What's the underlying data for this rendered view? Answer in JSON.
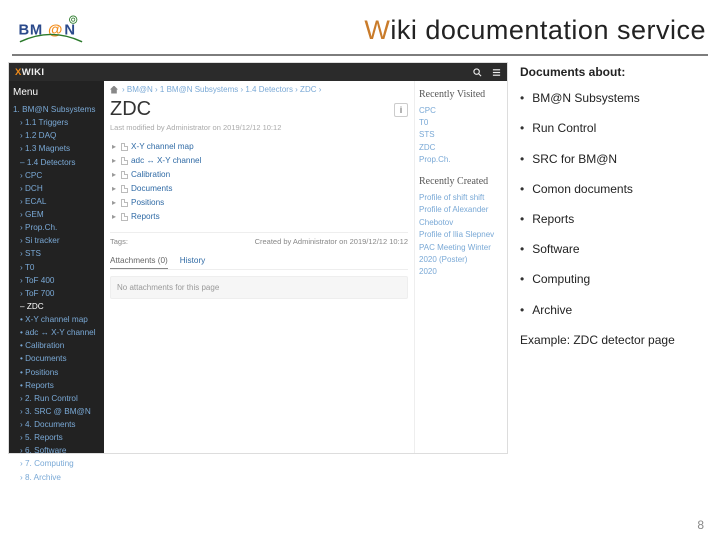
{
  "slide": {
    "title_pre": "W",
    "title_rest": "iki documentation service",
    "page_number": "8"
  },
  "logo": {
    "text": "BM@N"
  },
  "wiki": {
    "brand_x": "X",
    "brand_rest": "WIKI",
    "menu_heading": "Menu",
    "sidebar_items": [
      "1. BM@N Subsystems",
      "› 1.1 Triggers",
      "› 1.2 DAQ",
      "› 1.3 Magnets",
      "– 1.4 Detectors",
      "› CPC",
      "› DCH",
      "› ECAL",
      "› GEM",
      "› Prop.Ch.",
      "› Si tracker",
      "› STS",
      "› T0",
      "› ToF 400",
      "› ToF 700",
      "– ZDC",
      "• X-Y channel map",
      "• adc ↔ X-Y channel",
      "• Calibration",
      "• Documents",
      "• Positions",
      "• Reports",
      "› 2. Run Control",
      "› 3. SRC @ BM@N",
      "› 4. Documents",
      "› 5. Reports",
      "› 6. Software",
      "› 7. Computing",
      "› 8. Archive"
    ],
    "breadcrumbs": [
      "BM@N",
      "1 BM@N Subsystems",
      "1.4 Detectors",
      "ZDC"
    ],
    "page_title": "ZDC",
    "last_modified": "Last modified by Administrator on 2019/12/12 10:12",
    "tree": [
      "X-Y channel map",
      "adc ↔ X-Y channel",
      "Calibration",
      "Documents",
      "Positions",
      "Reports"
    ],
    "tags_label": "Tags:",
    "created_by": "Created by Administrator on 2019/12/12 10:12",
    "tabs": {
      "attachments": "Attachments (0)",
      "history": "History"
    },
    "no_attachments": "No attachments for this page",
    "info_btn": "i",
    "recently_visited": {
      "heading": "Recently Visited",
      "items": [
        "CPC",
        "T0",
        "STS",
        "ZDC",
        "Prop.Ch."
      ]
    },
    "recently_created": {
      "heading": "Recently Created",
      "items": [
        "Profile of shift shift",
        "Profile of Alexander Chebotov",
        "Profile of Ilia Slepnev",
        "PAC Meeting Winter 2020 (Poster)",
        "2020"
      ]
    }
  },
  "bullets": {
    "heading": "Documents about:",
    "items": [
      "BM@N Subsystems",
      "Run Control",
      "SRC for BM@N",
      "Comon documents",
      "Reports",
      "Software",
      "Computing",
      "Archive"
    ],
    "example": "Example: ZDC detector page"
  }
}
